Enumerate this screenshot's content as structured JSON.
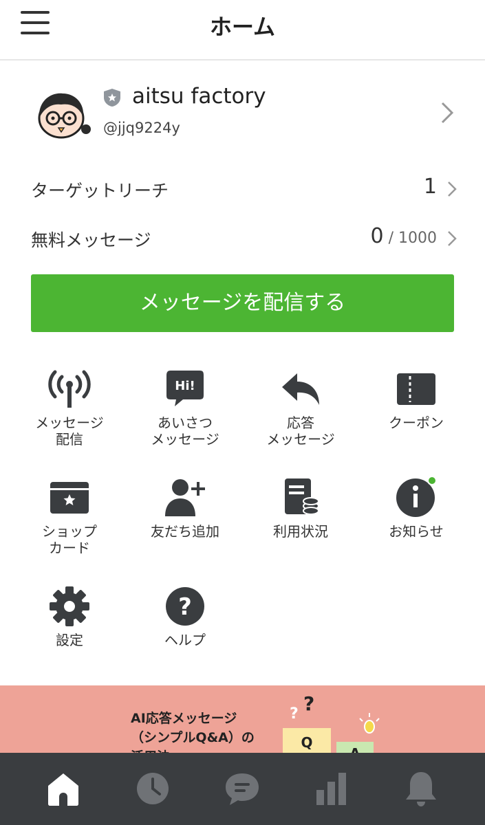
{
  "header": {
    "title": "ホーム",
    "menu_icon": "hamburger-menu-icon"
  },
  "profile": {
    "name": "aitsu factory",
    "id": "@jjq9224y",
    "badge_icon": "shield-star-icon"
  },
  "stats": [
    {
      "label": "ターゲットリーチ",
      "value": "1",
      "suffix": ""
    },
    {
      "label": "無料メッセージ",
      "value": "0",
      "suffix": " / 1000"
    }
  ],
  "send_button": "メッセージを配信する",
  "grid": [
    {
      "label": "メッセージ\n配信",
      "icon": "broadcast-antenna-icon"
    },
    {
      "label": "あいさつ\nメッセージ",
      "icon": "greeting-bubble-icon",
      "icon_text": "Hi!"
    },
    {
      "label": "応答\nメッセージ",
      "icon": "reply-arrow-icon"
    },
    {
      "label": "クーポン",
      "icon": "coupon-icon"
    },
    {
      "label": "ショップ\nカード",
      "icon": "shop-card-icon"
    },
    {
      "label": "友だち追加",
      "icon": "add-friend-icon"
    },
    {
      "label": "利用状況",
      "icon": "usage-report-icon"
    },
    {
      "label": "お知らせ",
      "icon": "info-icon",
      "badge_color": "#4cb533"
    },
    {
      "label": "設定",
      "icon": "gear-icon"
    },
    {
      "label": "ヘルプ",
      "icon": "help-icon"
    }
  ],
  "banner": {
    "text": "AI応答メッセージ\n（シンプルQ&A）の\n活用法",
    "art": {
      "q": "Q",
      "a": "A",
      "mark": "?"
    }
  },
  "tabbar": [
    {
      "name": "home",
      "icon": "home-icon",
      "active": true
    },
    {
      "name": "timeline",
      "icon": "clock-icon",
      "active": false
    },
    {
      "name": "chat",
      "icon": "chat-icon",
      "active": false
    },
    {
      "name": "analytics",
      "icon": "bar-chart-icon",
      "active": false
    },
    {
      "name": "notifications",
      "icon": "bell-icon",
      "active": false
    }
  ],
  "colors": {
    "accent": "#4cb533",
    "icon_dark": "#3a3d40",
    "tab_inactive": "#6f7276",
    "banner_bg": "#eea397"
  }
}
